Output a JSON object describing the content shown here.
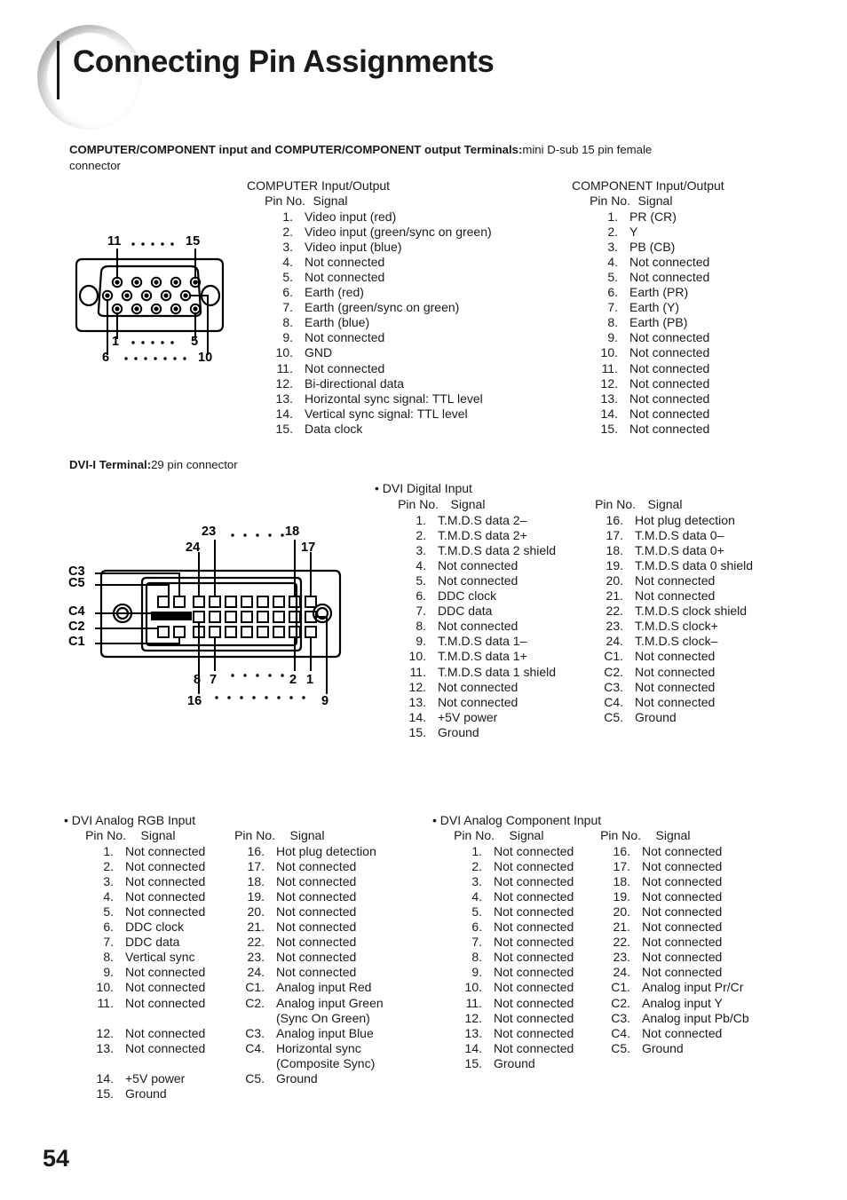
{
  "header": {
    "title": "Connecting Pin Assignments"
  },
  "page_number": "54",
  "section1": {
    "heading_bold": "COMPUTER/COMPONENT input and COMPUTER/COMPONENT output Terminals:",
    "heading_normal": "mini D-sub 15 pin female",
    "heading_line2": "connector",
    "diagram": {
      "name": "mini-d-sub-15-pin-female-connector",
      "labels": [
        "11",
        "15",
        "1",
        "5",
        "6",
        "10"
      ]
    },
    "computer": {
      "title": "COMPUTER Input/Output",
      "col_pin": "Pin No.",
      "col_signal": "Signal",
      "rows": [
        {
          "pin": "1.",
          "signal": "Video input (red)"
        },
        {
          "pin": "2.",
          "signal": "Video input (green/sync on green)"
        },
        {
          "pin": "3.",
          "signal": "Video input (blue)"
        },
        {
          "pin": "4.",
          "signal": "Not connected"
        },
        {
          "pin": "5.",
          "signal": "Not connected"
        },
        {
          "pin": "6.",
          "signal": "Earth (red)"
        },
        {
          "pin": "7.",
          "signal": "Earth (green/sync on green)"
        },
        {
          "pin": "8.",
          "signal": "Earth (blue)"
        },
        {
          "pin": "9.",
          "signal": "Not connected"
        },
        {
          "pin": "10.",
          "signal": "GND"
        },
        {
          "pin": "11.",
          "signal": "Not connected"
        },
        {
          "pin": "12.",
          "signal": "Bi-directional data"
        },
        {
          "pin": "13.",
          "signal": "Horizontal sync signal: TTL level"
        },
        {
          "pin": "14.",
          "signal": "Vertical sync signal: TTL level"
        },
        {
          "pin": "15.",
          "signal": "Data clock"
        }
      ]
    },
    "component": {
      "title": "COMPONENT Input/Output",
      "col_pin": "Pin No.",
      "col_signal": "Signal",
      "rows": [
        {
          "pin": "1.",
          "signal": "PR (CR)"
        },
        {
          "pin": "2.",
          "signal": "Y"
        },
        {
          "pin": "3.",
          "signal": "PB (CB)"
        },
        {
          "pin": "4.",
          "signal": "Not connected"
        },
        {
          "pin": "5.",
          "signal": "Not connected"
        },
        {
          "pin": "6.",
          "signal": "Earth (PR)"
        },
        {
          "pin": "7.",
          "signal": "Earth (Y)"
        },
        {
          "pin": "8.",
          "signal": "Earth (PB)"
        },
        {
          "pin": "9.",
          "signal": "Not connected"
        },
        {
          "pin": "10.",
          "signal": "Not connected"
        },
        {
          "pin": "11.",
          "signal": "Not connected"
        },
        {
          "pin": "12.",
          "signal": "Not connected"
        },
        {
          "pin": "13.",
          "signal": "Not connected"
        },
        {
          "pin": "14.",
          "signal": "Not connected"
        },
        {
          "pin": "15.",
          "signal": "Not connected"
        }
      ]
    }
  },
  "section2": {
    "heading_bold": "DVI-I Terminal:",
    "heading_normal": "29 pin connector",
    "diagram": {
      "name": "dvi-i-29-pin-connector",
      "labels": [
        "23",
        "18",
        "24",
        "17",
        "C3",
        "C5",
        "C4",
        "C2",
        "C1",
        "8",
        "7",
        "2",
        "1",
        "16",
        "9"
      ]
    },
    "digital": {
      "title": "• DVI Digital Input",
      "col_pin": "Pin No.",
      "col_signal": "Signal",
      "col_pin2": "Pin No.",
      "col_signal2": "Signal",
      "rows_left": [
        {
          "pin": "1.",
          "signal": "T.M.D.S data 2–"
        },
        {
          "pin": "2.",
          "signal": "T.M.D.S data 2+"
        },
        {
          "pin": "3.",
          "signal": "T.M.D.S data 2 shield"
        },
        {
          "pin": "4.",
          "signal": "Not connected"
        },
        {
          "pin": "5.",
          "signal": "Not connected"
        },
        {
          "pin": "6.",
          "signal": "DDC clock"
        },
        {
          "pin": "7.",
          "signal": "DDC data"
        },
        {
          "pin": "8.",
          "signal": "Not connected"
        },
        {
          "pin": "9.",
          "signal": "T.M.D.S data 1–"
        },
        {
          "pin": "10.",
          "signal": "T.M.D.S data 1+"
        },
        {
          "pin": "11.",
          "signal": "T.M.D.S data 1 shield"
        },
        {
          "pin": "12.",
          "signal": "Not connected"
        },
        {
          "pin": "13.",
          "signal": "Not connected"
        },
        {
          "pin": "14.",
          "signal": "+5V power"
        },
        {
          "pin": "15.",
          "signal": "Ground"
        }
      ],
      "rows_right": [
        {
          "pin": "16.",
          "signal": "Hot plug detection"
        },
        {
          "pin": "17.",
          "signal": "T.M.D.S data 0–"
        },
        {
          "pin": "18.",
          "signal": "T.M.D.S data 0+"
        },
        {
          "pin": "19.",
          "signal": "T.M.D.S data 0 shield"
        },
        {
          "pin": "20.",
          "signal": "Not connected"
        },
        {
          "pin": "21.",
          "signal": "Not connected"
        },
        {
          "pin": "22.",
          "signal": "T.M.D.S clock shield"
        },
        {
          "pin": "23.",
          "signal": "T.M.D.S clock+"
        },
        {
          "pin": "24.",
          "signal": "T.M.D.S clock–"
        },
        {
          "pin": "C1.",
          "signal": "Not connected"
        },
        {
          "pin": "C2.",
          "signal": "Not connected"
        },
        {
          "pin": "C3.",
          "signal": "Not connected"
        },
        {
          "pin": "C4.",
          "signal": "Not connected"
        },
        {
          "pin": "C5.",
          "signal": "Ground"
        }
      ]
    }
  },
  "section3": {
    "rgb": {
      "title": "• DVI Analog RGB Input",
      "col_pin": "Pin No.",
      "col_signal": "Signal",
      "col_pin2": "Pin No.",
      "col_signal2": "Signal",
      "rows_left": [
        {
          "pin": "1.",
          "signal": "Not connected"
        },
        {
          "pin": "2.",
          "signal": "Not connected"
        },
        {
          "pin": "3.",
          "signal": "Not connected"
        },
        {
          "pin": "4.",
          "signal": "Not connected"
        },
        {
          "pin": "5.",
          "signal": "Not connected"
        },
        {
          "pin": "6.",
          "signal": "DDC clock"
        },
        {
          "pin": "7.",
          "signal": "DDC data"
        },
        {
          "pin": "8.",
          "signal": "Vertical sync"
        },
        {
          "pin": "9.",
          "signal": "Not connected"
        },
        {
          "pin": "10.",
          "signal": "Not connected"
        },
        {
          "pin": "11.",
          "signal": "Not connected"
        },
        {
          "pin": "",
          "signal": ""
        },
        {
          "pin": "12.",
          "signal": "Not connected"
        },
        {
          "pin": "13.",
          "signal": "Not connected"
        },
        {
          "pin": "",
          "signal": ""
        },
        {
          "pin": "14.",
          "signal": "+5V power"
        },
        {
          "pin": "15.",
          "signal": "Ground"
        }
      ],
      "rows_right": [
        {
          "pin": "16.",
          "signal": "Hot plug detection"
        },
        {
          "pin": "17.",
          "signal": "Not connected"
        },
        {
          "pin": "18.",
          "signal": "Not connected"
        },
        {
          "pin": "19.",
          "signal": "Not connected"
        },
        {
          "pin": "20.",
          "signal": "Not connected"
        },
        {
          "pin": "21.",
          "signal": "Not connected"
        },
        {
          "pin": "22.",
          "signal": "Not connected"
        },
        {
          "pin": "23.",
          "signal": "Not connected"
        },
        {
          "pin": "24.",
          "signal": "Not connected"
        },
        {
          "pin": "C1.",
          "signal": "Analog input Red"
        },
        {
          "pin": "C2.",
          "signal": "Analog input Green"
        },
        {
          "pin": "",
          "signal": "(Sync On Green)"
        },
        {
          "pin": "C3.",
          "signal": "Analog input Blue"
        },
        {
          "pin": "C4.",
          "signal": "Horizontal sync"
        },
        {
          "pin": "",
          "signal": "(Composite Sync)"
        },
        {
          "pin": "C5.",
          "signal": "Ground"
        },
        {
          "pin": "",
          "signal": ""
        }
      ]
    },
    "component": {
      "title": "• DVI Analog Component Input",
      "col_pin": "Pin No.",
      "col_signal": "Signal",
      "col_pin2": "Pin No.",
      "col_signal2": "Signal",
      "rows_left": [
        {
          "pin": "1.",
          "signal": "Not connected"
        },
        {
          "pin": "2.",
          "signal": "Not connected"
        },
        {
          "pin": "3.",
          "signal": "Not connected"
        },
        {
          "pin": "4.",
          "signal": "Not connected"
        },
        {
          "pin": "5.",
          "signal": "Not connected"
        },
        {
          "pin": "6.",
          "signal": "Not connected"
        },
        {
          "pin": "7.",
          "signal": "Not connected"
        },
        {
          "pin": "8.",
          "signal": "Not connected"
        },
        {
          "pin": "9.",
          "signal": "Not connected"
        },
        {
          "pin": "10.",
          "signal": "Not connected"
        },
        {
          "pin": "11.",
          "signal": "Not connected"
        },
        {
          "pin": "12.",
          "signal": "Not connected"
        },
        {
          "pin": "13.",
          "signal": "Not connected"
        },
        {
          "pin": "14.",
          "signal": "Not connected"
        },
        {
          "pin": "15.",
          "signal": "Ground"
        }
      ],
      "rows_right": [
        {
          "pin": "16.",
          "signal": "Not connected"
        },
        {
          "pin": "17.",
          "signal": "Not connected"
        },
        {
          "pin": "18.",
          "signal": "Not connected"
        },
        {
          "pin": "19.",
          "signal": "Not connected"
        },
        {
          "pin": "20.",
          "signal": "Not connected"
        },
        {
          "pin": "21.",
          "signal": "Not connected"
        },
        {
          "pin": "22.",
          "signal": "Not connected"
        },
        {
          "pin": "23.",
          "signal": "Not connected"
        },
        {
          "pin": "24.",
          "signal": "Not connected"
        },
        {
          "pin": "C1.",
          "signal": "Analog input Pr/Cr"
        },
        {
          "pin": "C2.",
          "signal": "Analog input Y"
        },
        {
          "pin": "C3.",
          "signal": "Analog input Pb/Cb"
        },
        {
          "pin": "C4.",
          "signal": "Not connected"
        },
        {
          "pin": "C5.",
          "signal": "Ground"
        }
      ]
    }
  }
}
